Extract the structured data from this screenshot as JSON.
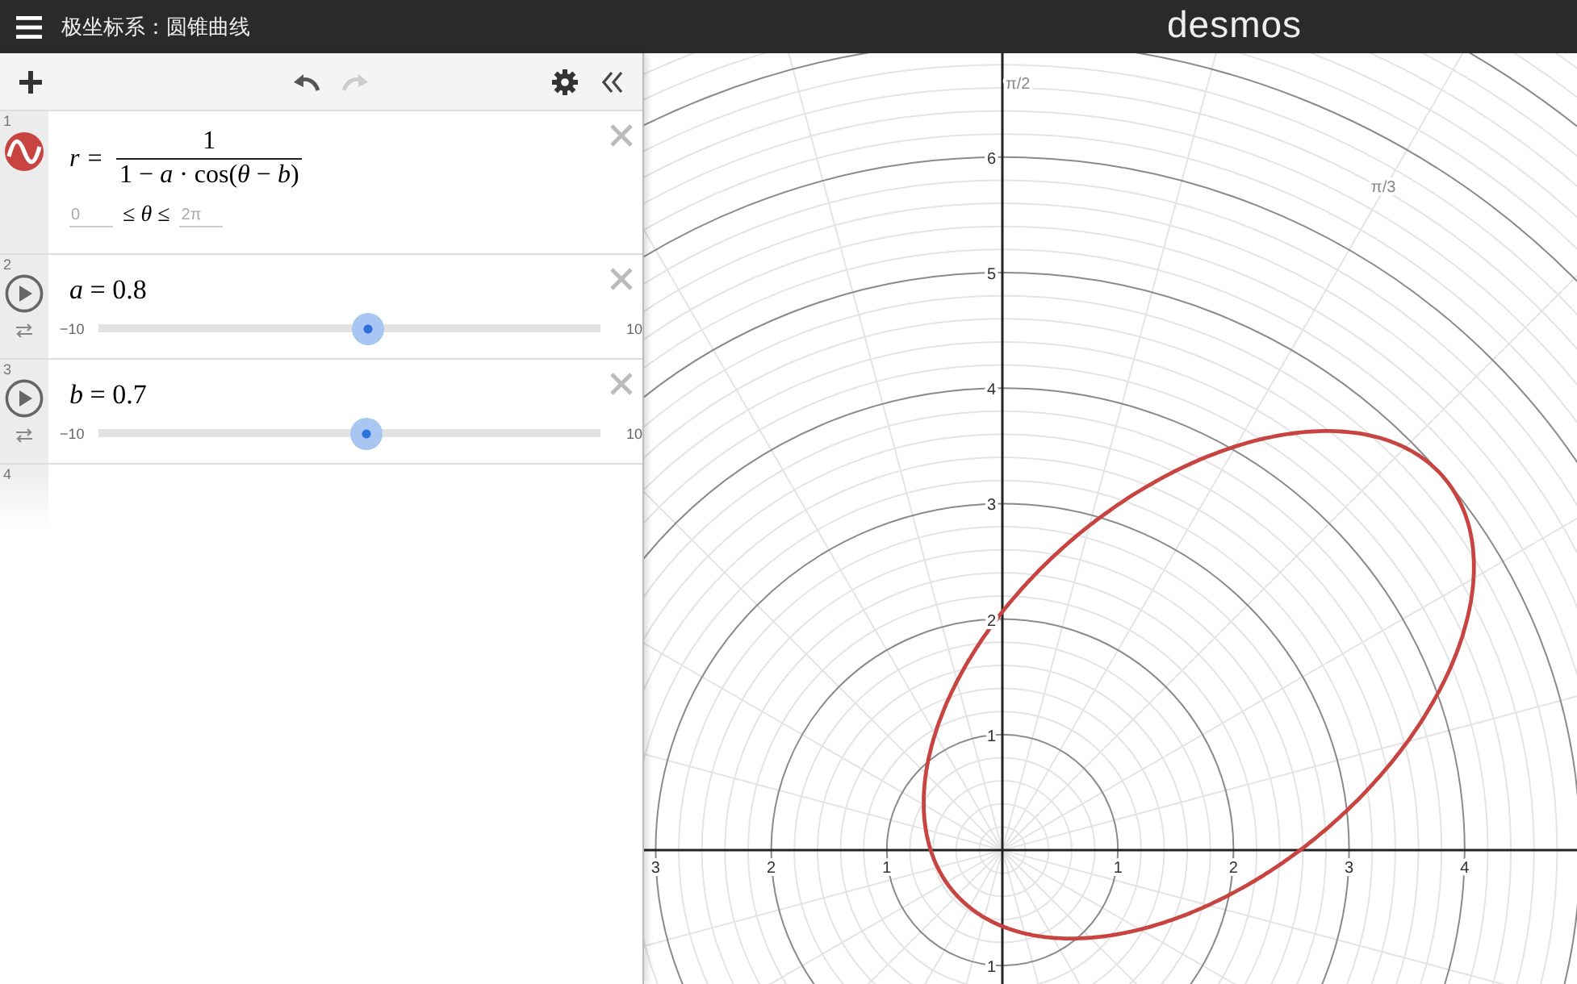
{
  "header": {
    "title": "极坐标系：圆锥曲线",
    "logo": "desmos"
  },
  "expressions": [
    {
      "kind": "function",
      "number": "1",
      "lhs": "r =",
      "numerator": "1",
      "denominator": "1 − *a* · cos(*θ* − *b*)",
      "domain_min": {
        "placeholder": "0"
      },
      "domain_relation": "≤ *θ* ≤",
      "domain_max": {
        "placeholder": "2π"
      }
    },
    {
      "kind": "slider",
      "number": "2",
      "formula": "*a* = 0.8",
      "min": "−10",
      "max": "10",
      "level": 0.54
    },
    {
      "kind": "slider",
      "number": "3",
      "formula": "*b* = 0.7",
      "min": "−10",
      "max": "10",
      "level": 0.535
    },
    {
      "kind": "empty",
      "number": "4"
    }
  ],
  "graph": {
    "x_ticks": [
      "3",
      "2",
      "1",
      "1",
      "2",
      "3",
      "4"
    ],
    "y_ticks": [
      "6",
      "5",
      "4",
      "3",
      "2",
      "1",
      "1"
    ],
    "angle_labels": [
      "π/2",
      "π/3"
    ]
  }
}
